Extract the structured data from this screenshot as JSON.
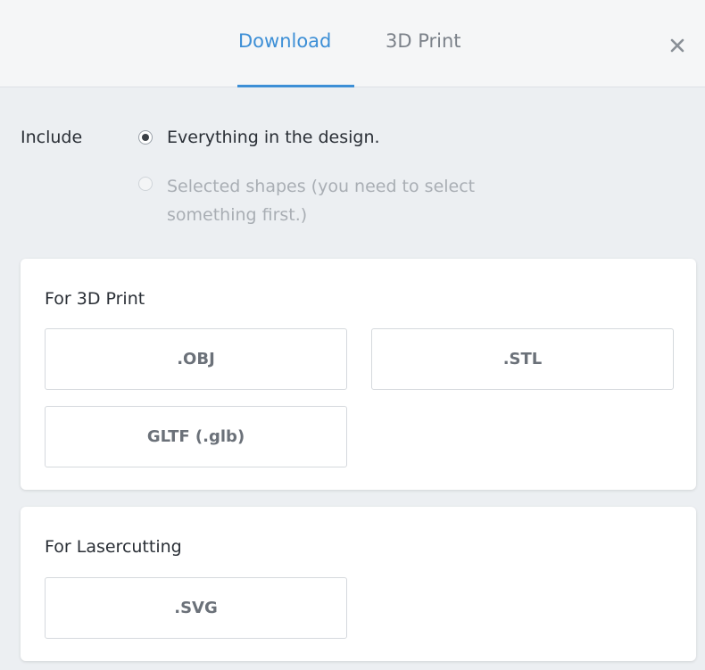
{
  "tabs": {
    "download": "Download",
    "print3d": "3D Print"
  },
  "include": {
    "label": "Include",
    "option_everything": "Everything in the design.",
    "option_selected": "Selected shapes (you need to select something first.)"
  },
  "sections": {
    "print3d": {
      "title": "For 3D Print",
      "buttons": [
        ".OBJ",
        ".STL",
        "GLTF (.glb)"
      ]
    },
    "lasercutting": {
      "title": "For Lasercutting",
      "buttons": [
        ".SVG"
      ]
    }
  },
  "colors": {
    "accent": "#3d8fd6",
    "background": "#eceff2"
  },
  "icons": {
    "close": "close-icon"
  }
}
